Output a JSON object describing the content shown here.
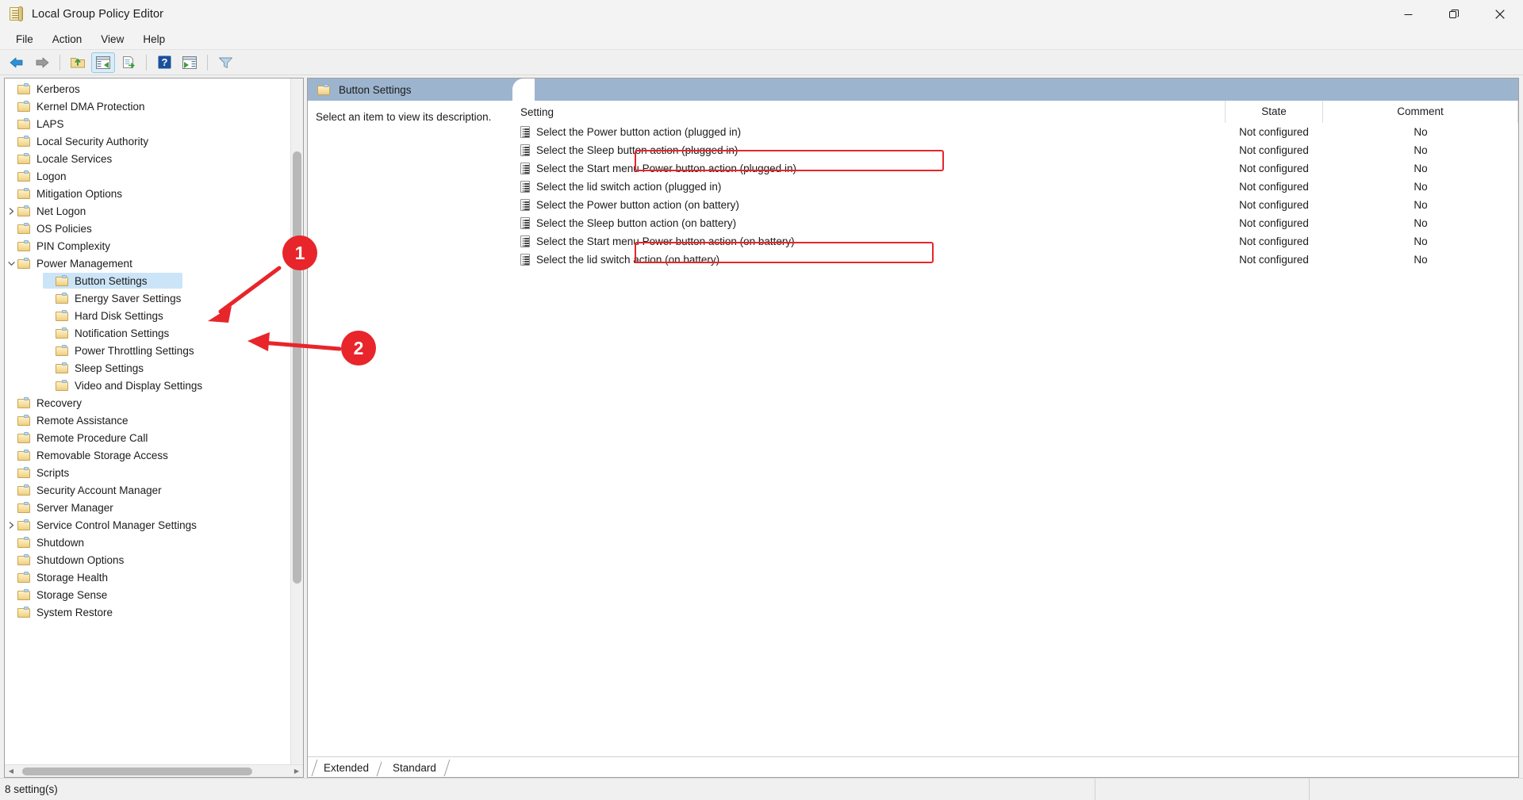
{
  "window": {
    "title": "Local Group Policy Editor",
    "icon": "policy-document-icon",
    "controls": {
      "minimize": "Minimize",
      "maximize": "Restore",
      "close": "Close"
    }
  },
  "menubar": {
    "items": [
      {
        "label": "File"
      },
      {
        "label": "Action"
      },
      {
        "label": "View"
      },
      {
        "label": "Help"
      }
    ]
  },
  "toolbar": {
    "buttons": [
      {
        "name": "back-icon",
        "title": "Back"
      },
      {
        "name": "forward-icon",
        "title": "Forward"
      },
      {
        "name": "up-one-level-icon",
        "title": "Up One Level"
      },
      {
        "name": "show-hide-console-tree-icon",
        "title": "Show/Hide Console Tree"
      },
      {
        "name": "export-list-icon",
        "title": "Export List"
      },
      {
        "name": "help-icon",
        "title": "Help"
      },
      {
        "name": "show-hide-action-pane-icon",
        "title": "Show/Hide Action Pane"
      },
      {
        "name": "filter-icon",
        "title": "Filter"
      }
    ]
  },
  "tree": {
    "items": [
      {
        "label": "Kerberos",
        "indent": 0,
        "twisty": "",
        "selected": false
      },
      {
        "label": "Kernel DMA Protection",
        "indent": 0,
        "twisty": "",
        "selected": false
      },
      {
        "label": "LAPS",
        "indent": 0,
        "twisty": "",
        "selected": false
      },
      {
        "label": "Local Security Authority",
        "indent": 0,
        "twisty": "",
        "selected": false
      },
      {
        "label": "Locale Services",
        "indent": 0,
        "twisty": "",
        "selected": false
      },
      {
        "label": "Logon",
        "indent": 0,
        "twisty": "",
        "selected": false
      },
      {
        "label": "Mitigation Options",
        "indent": 0,
        "twisty": "",
        "selected": false
      },
      {
        "label": "Net Logon",
        "indent": 0,
        "twisty": "collapsed",
        "selected": false
      },
      {
        "label": "OS Policies",
        "indent": 0,
        "twisty": "",
        "selected": false
      },
      {
        "label": "PIN Complexity",
        "indent": 0,
        "twisty": "",
        "selected": false
      },
      {
        "label": "Power Management",
        "indent": 0,
        "twisty": "expanded",
        "selected": false
      },
      {
        "label": "Button Settings",
        "indent": 1,
        "twisty": "",
        "selected": true
      },
      {
        "label": "Energy Saver Settings",
        "indent": 1,
        "twisty": "",
        "selected": false
      },
      {
        "label": "Hard Disk Settings",
        "indent": 1,
        "twisty": "",
        "selected": false
      },
      {
        "label": "Notification Settings",
        "indent": 1,
        "twisty": "",
        "selected": false
      },
      {
        "label": "Power Throttling Settings",
        "indent": 1,
        "twisty": "",
        "selected": false
      },
      {
        "label": "Sleep Settings",
        "indent": 1,
        "twisty": "",
        "selected": false
      },
      {
        "label": "Video and Display Settings",
        "indent": 1,
        "twisty": "",
        "selected": false
      },
      {
        "label": "Recovery",
        "indent": 0,
        "twisty": "",
        "selected": false
      },
      {
        "label": "Remote Assistance",
        "indent": 0,
        "twisty": "",
        "selected": false
      },
      {
        "label": "Remote Procedure Call",
        "indent": 0,
        "twisty": "",
        "selected": false
      },
      {
        "label": "Removable Storage Access",
        "indent": 0,
        "twisty": "",
        "selected": false
      },
      {
        "label": "Scripts",
        "indent": 0,
        "twisty": "",
        "selected": false
      },
      {
        "label": "Security Account Manager",
        "indent": 0,
        "twisty": "",
        "selected": false
      },
      {
        "label": "Server Manager",
        "indent": 0,
        "twisty": "",
        "selected": false
      },
      {
        "label": "Service Control Manager Settings",
        "indent": 0,
        "twisty": "collapsed",
        "selected": false
      },
      {
        "label": "Shutdown",
        "indent": 0,
        "twisty": "",
        "selected": false
      },
      {
        "label": "Shutdown Options",
        "indent": 0,
        "twisty": "",
        "selected": false
      },
      {
        "label": "Storage Health",
        "indent": 0,
        "twisty": "",
        "selected": false
      },
      {
        "label": "Storage Sense",
        "indent": 0,
        "twisty": "",
        "selected": false
      },
      {
        "label": "System Restore",
        "indent": 0,
        "twisty": "",
        "selected": false
      }
    ]
  },
  "right_pane": {
    "header_title": "Button Settings",
    "header_icon": "folder-icon",
    "description": "Select an item to view its description.",
    "columns": {
      "setting": "Setting",
      "state": "State",
      "comment": "Comment"
    },
    "rows": [
      {
        "setting": "Select the Power button action (plugged in)",
        "state": "Not configured",
        "comment": "No",
        "highlight": true
      },
      {
        "setting": "Select the Sleep button action (plugged in)",
        "state": "Not configured",
        "comment": "No",
        "highlight": false
      },
      {
        "setting": "Select the Start menu Power button action (plugged in)",
        "state": "Not configured",
        "comment": "No",
        "highlight": false
      },
      {
        "setting": "Select the lid switch action (plugged in)",
        "state": "Not configured",
        "comment": "No",
        "highlight": false
      },
      {
        "setting": "Select the Power button action (on battery)",
        "state": "Not configured",
        "comment": "No",
        "highlight": true
      },
      {
        "setting": "Select the Sleep button action (on battery)",
        "state": "Not configured",
        "comment": "No",
        "highlight": false
      },
      {
        "setting": "Select the Start menu Power button action (on battery)",
        "state": "Not configured",
        "comment": "No",
        "highlight": false
      },
      {
        "setting": "Select the lid switch action (on battery)",
        "state": "Not configured",
        "comment": "No",
        "highlight": false
      }
    ]
  },
  "tabs": [
    {
      "label": "Extended",
      "active": false
    },
    {
      "label": "Standard",
      "active": true
    }
  ],
  "statusbar": {
    "text": "8 setting(s)"
  },
  "annotations": {
    "accent_color": "#e8252a",
    "badges": [
      {
        "number": "1"
      },
      {
        "number": "2"
      }
    ]
  }
}
